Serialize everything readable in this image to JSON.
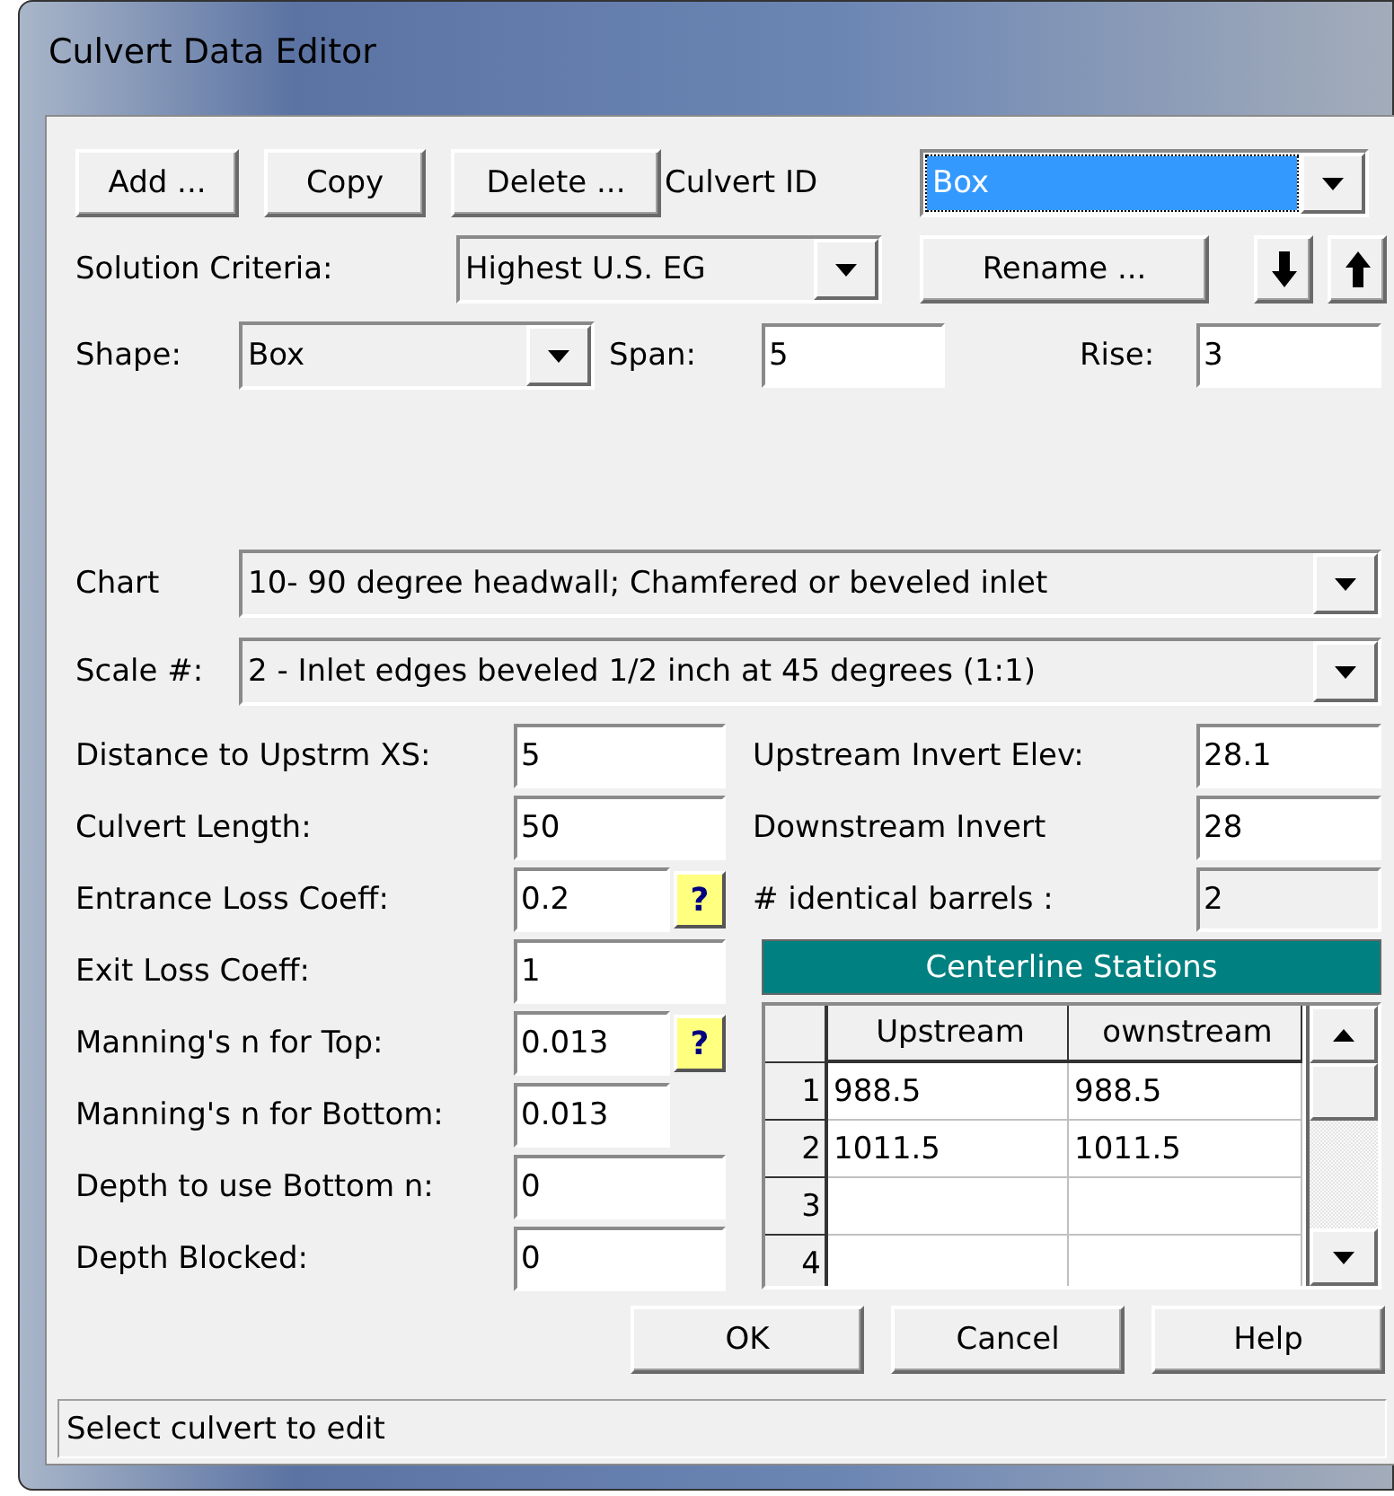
{
  "window": {
    "title": "Culvert Data Editor"
  },
  "toolbar_buttons": [
    {
      "label": "Add ..."
    },
    {
      "label": "Copy"
    },
    {
      "label": "Delete ..."
    }
  ],
  "culvert_id": {
    "label": "Culvert ID",
    "value": "Box",
    "highlighted": true
  },
  "solution_criteria": {
    "label": "Solution Criteria:",
    "value": "Highest U.S. EG"
  },
  "rename_button": {
    "label": "Rename ..."
  },
  "shape": {
    "label": "Shape:",
    "value": "Box"
  },
  "span": {
    "label": "Span:",
    "value": "5"
  },
  "rise": {
    "label": "Rise:",
    "value": "3"
  },
  "chart": {
    "label": "Chart",
    "value": "10- 90 degree headwall; Chamfered or beveled inlet"
  },
  "scale": {
    "label": "Scale #:",
    "value": "2 - Inlet edges beveled 1/2 inch at 45 degrees (1:1)"
  },
  "left_fields": [
    {
      "label": "Distance to Upstrm XS:",
      "value": "5",
      "kind": "wide"
    },
    {
      "label": "Culvert Length:",
      "value": "50",
      "kind": "wide"
    },
    {
      "label": "Entrance Loss Coeff:",
      "value": "0.2",
      "kind": "short",
      "help": "?"
    },
    {
      "label": "Exit Loss Coeff:",
      "value": "1",
      "kind": "wide"
    },
    {
      "label": "Manning's n for Top:",
      "value": "0.013",
      "kind": "short",
      "help": "?"
    },
    {
      "label": "Manning's n for Bottom:",
      "value": "0.013",
      "kind": "short"
    },
    {
      "label": "Depth to use Bottom n:",
      "value": "0",
      "kind": "wide"
    },
    {
      "label": "Depth Blocked:",
      "value": "0",
      "kind": "wide"
    }
  ],
  "right_fields": [
    {
      "label": "Upstream Invert Elev:",
      "value": "28.1",
      "disabled": false
    },
    {
      "label": "Downstream Invert",
      "value": "28",
      "disabled": false
    },
    {
      "label": "# identical barrels :",
      "value": "2",
      "disabled": true
    }
  ],
  "centerline": {
    "title": "Centerline Stations",
    "columns": [
      "Upstream",
      "ownstream"
    ],
    "rows": [
      {
        "number": "1",
        "cells": [
          "988.5",
          "988.5"
        ]
      },
      {
        "number": "2",
        "cells": [
          "1011.5",
          "1011.5"
        ]
      },
      {
        "number": "3"
      },
      {
        "number": "4"
      }
    ]
  },
  "buttons": [
    {
      "label": "OK"
    },
    {
      "label": "Cancel"
    },
    {
      "label": "Help"
    }
  ],
  "status_bar": "Select culvert to edit"
}
